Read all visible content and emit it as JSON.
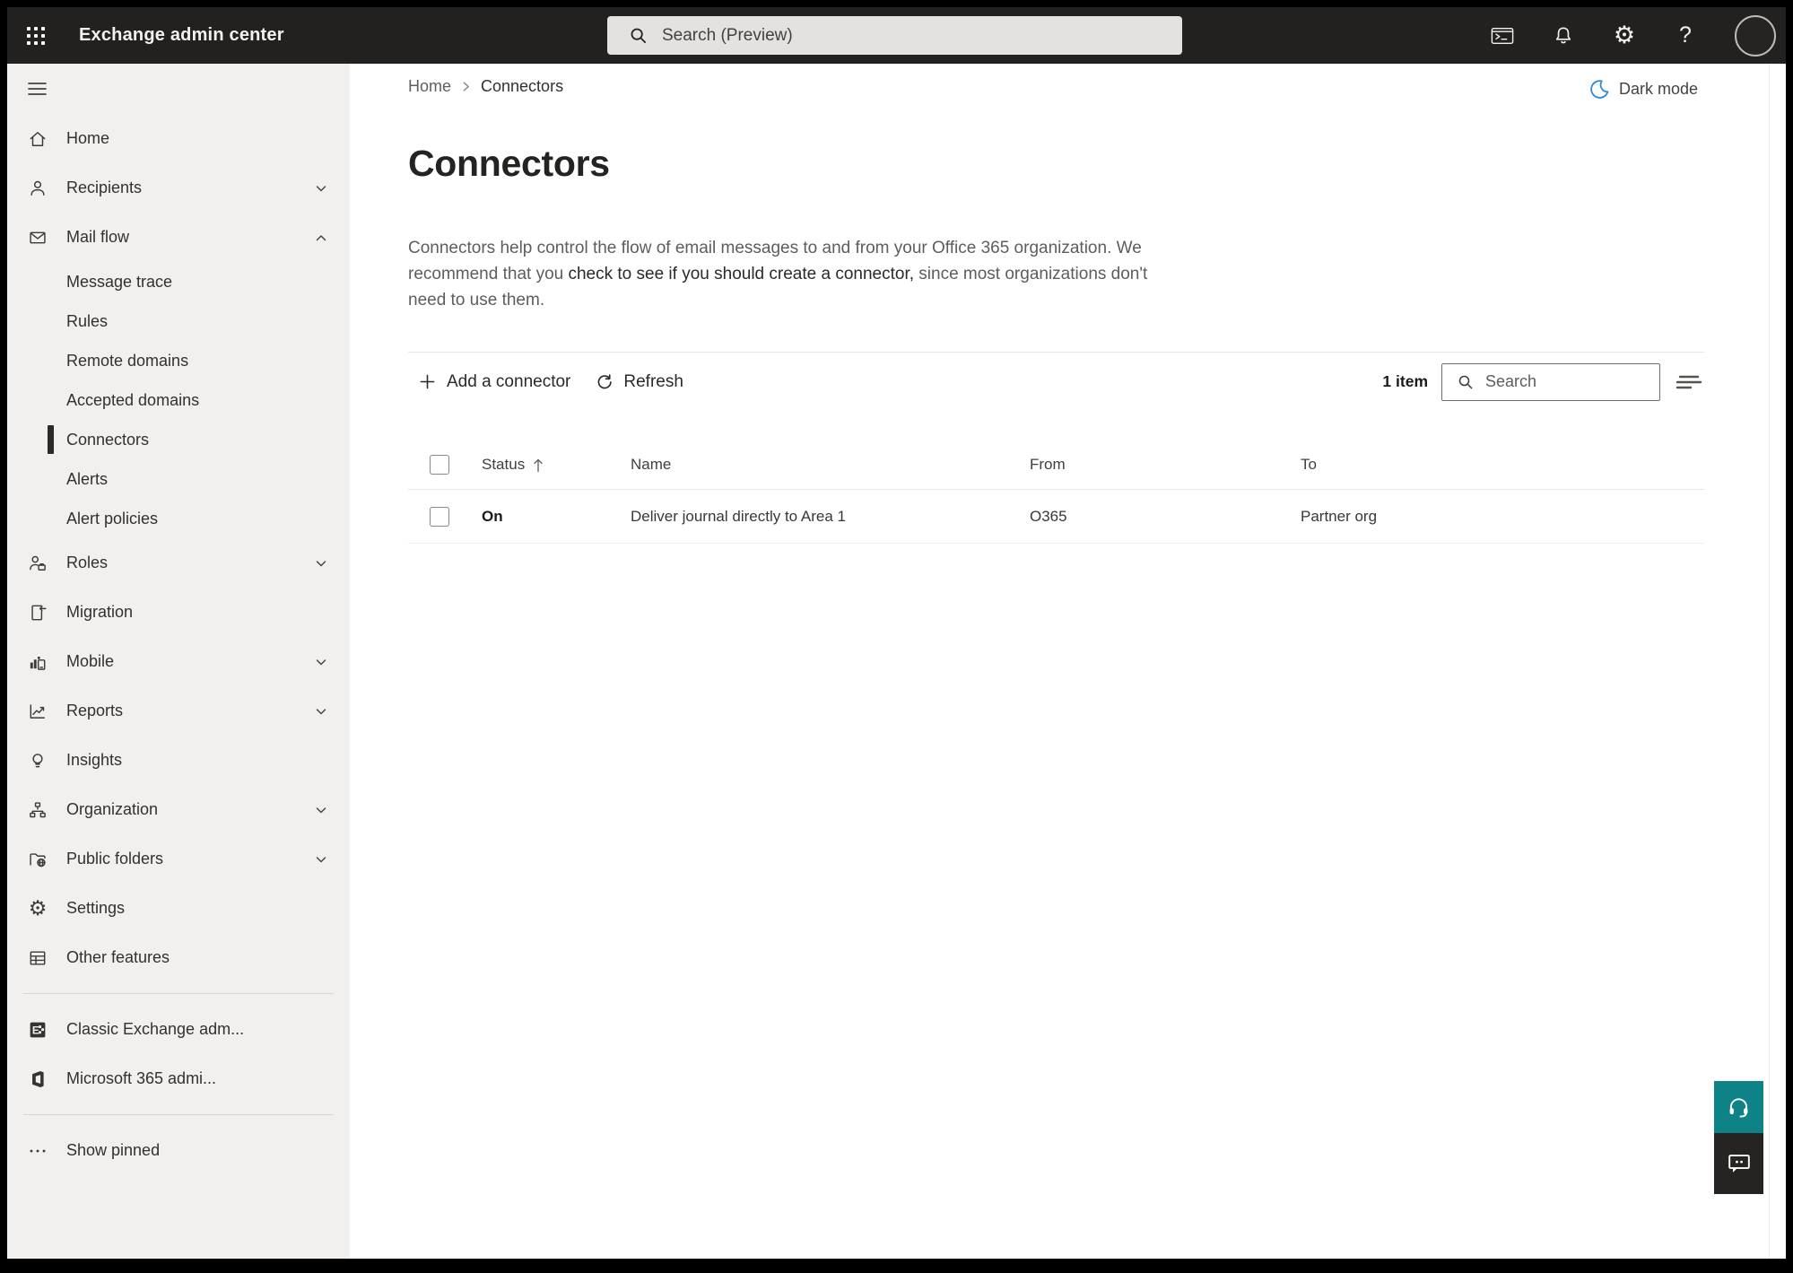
{
  "topbar": {
    "app_title": "Exchange admin center",
    "search_placeholder": "Search (Preview)"
  },
  "breadcrumb": {
    "home": "Home",
    "current": "Connectors"
  },
  "header": {
    "dark_mode_label": "Dark mode"
  },
  "page": {
    "title": "Connectors",
    "description_before_link": "Connectors help control the flow of email messages to and from your Office 365 organization. We recommend that you ",
    "description_link": "check to see if you should create a connector,",
    "description_after_link": " since most organizations don't need to use them."
  },
  "toolbar": {
    "add_connector_label": "Add a connector",
    "refresh_label": "Refresh",
    "item_count": "1 item",
    "search_placeholder": "Search"
  },
  "table": {
    "columns": {
      "status": "Status",
      "name": "Name",
      "from": "From",
      "to": "To"
    },
    "rows": [
      {
        "status": "On",
        "name": "Deliver journal directly to Area 1",
        "from": "O365",
        "to": "Partner org"
      }
    ]
  },
  "sidebar": {
    "items": [
      {
        "label": "Home"
      },
      {
        "label": "Recipients"
      },
      {
        "label": "Mail flow"
      },
      {
        "label": "Message trace"
      },
      {
        "label": "Rules"
      },
      {
        "label": "Remote domains"
      },
      {
        "label": "Accepted domains"
      },
      {
        "label": "Connectors"
      },
      {
        "label": "Alerts"
      },
      {
        "label": "Alert policies"
      },
      {
        "label": "Roles"
      },
      {
        "label": "Migration"
      },
      {
        "label": "Mobile"
      },
      {
        "label": "Reports"
      },
      {
        "label": "Insights"
      },
      {
        "label": "Organization"
      },
      {
        "label": "Public folders"
      },
      {
        "label": "Settings"
      },
      {
        "label": "Other features"
      },
      {
        "label": "Classic Exchange adm..."
      },
      {
        "label": "Microsoft 365 admi..."
      },
      {
        "label": "Show pinned"
      }
    ]
  },
  "icons": {
    "app_launcher": "waffle-grid",
    "topbar_search": "magnifier",
    "terminal": "powershell-window",
    "notifications": "bell",
    "settings": "gear",
    "help": "question-mark",
    "dark_mode": "crescent-moon",
    "sort": "arrow-up",
    "filter": "lines",
    "help_fab": "headset",
    "feedback_fab": "speech-bubble"
  },
  "colors": {
    "topbar_bg": "#222120",
    "sidebar_bg": "#f1f0ef",
    "selection_bar": "#2b2a29",
    "moon_blue": "#2b88d8",
    "fab_teal": "#0e8387",
    "fab_dark": "#252423"
  }
}
